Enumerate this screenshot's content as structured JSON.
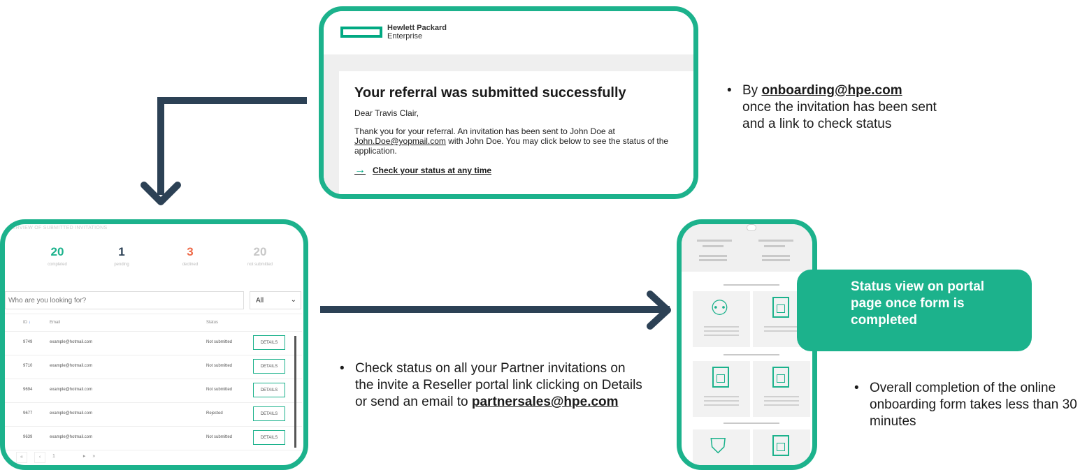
{
  "email": {
    "logo_line1": "Hewlett Packard",
    "logo_line2": "Enterprise",
    "title": "Your referral was submitted successfully",
    "greeting": "Dear Travis Clair,",
    "body_before_link": "Thank you for your referral. An invitation has been sent to John Doe at",
    "body_email": "John.Doe@yopmail.com",
    "body_after_link": "with John Doe. You may click below to see the status of the application.",
    "cta": "Check your status at any time"
  },
  "bullet_top": {
    "prefix": "By",
    "email": "onboarding@hpe.com",
    "text": "once the invitation has been sent and a link to check status"
  },
  "dashboard": {
    "caption": "OVERVIEW OF SUBMITTED INVITATIONS",
    "stats": [
      {
        "value": "20",
        "label": "completed",
        "color": "#1cb28c"
      },
      {
        "value": "1",
        "label": "pending",
        "color": "#2c4155"
      },
      {
        "value": "3",
        "label": "declined",
        "color": "#ee6b4a"
      },
      {
        "value": "20",
        "label": "not submitted",
        "color": "#c8c8c8"
      }
    ],
    "search_placeholder": "Who are you looking for?",
    "filter_value": "All",
    "columns": {
      "id": "ID",
      "email": "Email",
      "status": "Status"
    },
    "rows": [
      {
        "id": "9749",
        "email": "example@hotmail.com",
        "status": "Not submitted",
        "action": "DETAILS"
      },
      {
        "id": "9710",
        "email": "example@hotmail.com",
        "status": "Not submitted",
        "action": "DETAILS"
      },
      {
        "id": "9694",
        "email": "example@hotmail.com",
        "status": "Not submitted",
        "action": "DETAILS"
      },
      {
        "id": "9677",
        "email": "example@hotmail.com",
        "status": "Rejected",
        "action": "DETAILS"
      },
      {
        "id": "9639",
        "email": "example@hotmail.com",
        "status": "Not submitted",
        "action": "DETAILS"
      }
    ],
    "page": "1"
  },
  "bullet_middle": {
    "text": "Check status on all your Partner invitations on the invite a Reseller portal link clicking on Details or send an email to",
    "email": "partnersales@hpe.com"
  },
  "status_badge": {
    "text": "Status view on portal page once form is completed"
  },
  "bullet_right": {
    "text": "Overall completion of the online onboarding form takes less than 30 minutes"
  },
  "colors": {
    "accent": "#1cb28c",
    "connector": "#2c4155"
  }
}
